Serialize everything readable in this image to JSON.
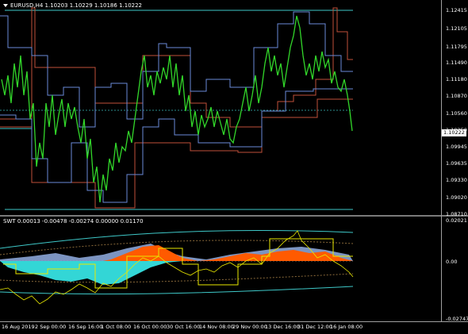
{
  "chart": {
    "symbol_label": "EURUSD,H4",
    "ohlc": "1.10203 1.10229 1.10186 1.10222",
    "current_price": "1.10222",
    "price_ticks": [
      "1.12415",
      "1.12105",
      "1.11795",
      "1.11490",
      "1.11180",
      "1.10870",
      "1.10560",
      "1.10250",
      "1.09945",
      "1.09635",
      "1.09330",
      "1.09020",
      "1.08710"
    ],
    "indicator_title": "SWT 0.00013 -0.00478 -0.00274 0.00000 0.01170",
    "indicator_ticks": [
      "0.02021",
      "0.00",
      "-0.02747"
    ],
    "time_labels": [
      "16 Aug 2019",
      "2 Sep 00:00",
      "16 Sep 16:00",
      "1 Oct 08:00",
      "16 Oct 00:00",
      "30 Oct 16:00",
      "14 Nov 08:00",
      "29 Nov 00:00",
      "13 Dec 16:00",
      "31 Dec 12:00",
      "16 Jan 08:00"
    ]
  },
  "colors": {
    "background": "#000000",
    "price_line": "#32d72a",
    "upper_band": "#c0503a",
    "lower_band": "#6a8ad8",
    "outer_band": "#3ec8c8",
    "hist_blue": "#8aa4d6",
    "hist_orange": "#ff5a00",
    "hist_cyan": "#33d6d6",
    "yellow_line": "#e8e800"
  }
}
